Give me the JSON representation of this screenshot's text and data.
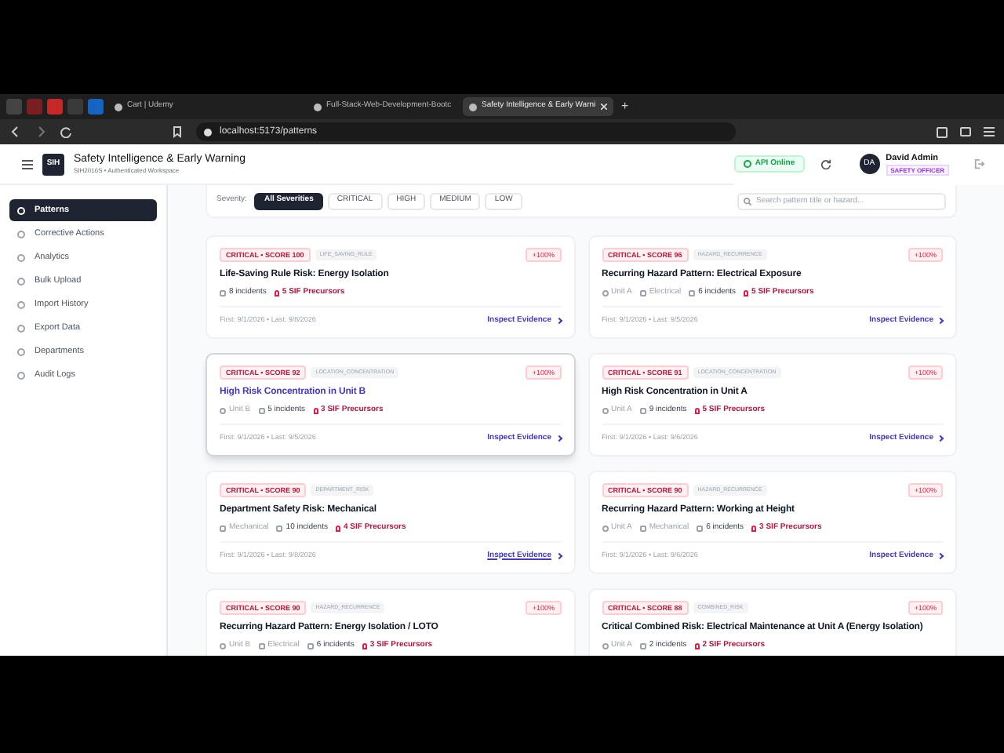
{
  "browser": {
    "tabs": [
      {
        "label": "Cart | Udemy",
        "selected": false
      },
      {
        "label": "Full-Stack-Web-Development-Bootc",
        "selected": false
      },
      {
        "label": "Safety Intelligence & Early Warni",
        "selected": true
      }
    ],
    "new_tab": "+",
    "url": "localhost:5173/patterns"
  },
  "header": {
    "logo": "SIH",
    "title": "Safety Intelligence & Early Warning",
    "subtitle": "SIH2016S • Authenticated Workspace",
    "api_status": "API Online",
    "user": {
      "initials": "DA",
      "name": "David Admin",
      "role": "SAFETY OFFICER"
    }
  },
  "sidebar": {
    "items": [
      {
        "label": "Patterns",
        "selected": true
      },
      {
        "label": "Corrective Actions",
        "selected": false
      },
      {
        "label": "Analytics",
        "selected": false
      },
      {
        "label": "Bulk Upload",
        "selected": false
      },
      {
        "label": "Import History",
        "selected": false
      },
      {
        "label": "Export Data",
        "selected": false
      },
      {
        "label": "Departments",
        "selected": false
      },
      {
        "label": "Audit Logs",
        "selected": false
      }
    ]
  },
  "filters": {
    "label": "Severity:",
    "options": [
      {
        "label": "All Severities",
        "selected": true
      },
      {
        "label": "CRITICAL",
        "selected": false
      },
      {
        "label": "HIGH",
        "selected": false
      },
      {
        "label": "MEDIUM",
        "selected": false
      },
      {
        "label": "LOW",
        "selected": false
      }
    ],
    "search_placeholder": "Search pattern title or hazard..."
  },
  "cards": [
    {
      "severity": "CRITICAL • SCORE 100",
      "category": "LIFE_SAVING_RULE",
      "change": "+100%",
      "title": "Life-Saving Rule Risk: Energy Isolation",
      "hovered": false,
      "meta": [
        {
          "kind": "incidents",
          "text": "8 incidents"
        }
      ],
      "sif": "5 SIF Precursors",
      "dates": "First: 9/1/2026 • Last: 9/8/2026",
      "link": "Inspect Evidence",
      "link_hovered": false
    },
    {
      "severity": "CRITICAL • SCORE 96",
      "category": "HAZARD_RECURRENCE",
      "change": "+100%",
      "title": "Recurring Hazard Pattern: Electrical Exposure",
      "hovered": false,
      "meta": [
        {
          "kind": "location",
          "text": "Unit A"
        },
        {
          "kind": "department",
          "text": "Electrical"
        },
        {
          "kind": "incidents",
          "text": "6 incidents"
        }
      ],
      "sif": "5 SIF Precursors",
      "dates": "First: 9/1/2026 • Last: 9/5/2026",
      "link": "Inspect Evidence",
      "link_hovered": false
    },
    {
      "severity": "CRITICAL • SCORE 92",
      "category": "LOCATION_CONCENTRATION",
      "change": "+100%",
      "title": "High Risk Concentration in Unit B",
      "hovered": true,
      "meta": [
        {
          "kind": "location",
          "text": "Unit B"
        },
        {
          "kind": "incidents",
          "text": "5 incidents"
        }
      ],
      "sif": "3 SIF Precursors",
      "dates": "First: 9/1/2026 • Last: 9/5/2026",
      "link": "Inspect Evidence",
      "link_hovered": false
    },
    {
      "severity": "CRITICAL • SCORE 91",
      "category": "LOCATION_CONCENTRATION",
      "change": "+100%",
      "title": "High Risk Concentration in Unit A",
      "hovered": false,
      "meta": [
        {
          "kind": "location",
          "text": "Unit A"
        },
        {
          "kind": "incidents",
          "text": "9 incidents"
        }
      ],
      "sif": "5 SIF Precursors",
      "dates": "First: 9/1/2026 • Last: 9/6/2026",
      "link": "Inspect Evidence",
      "link_hovered": false
    },
    {
      "severity": "CRITICAL • SCORE 90",
      "category": "DEPARTMENT_RISK",
      "title": "Department Safety Risk: Mechanical",
      "hovered": false,
      "meta": [
        {
          "kind": "department",
          "text": "Mechanical"
        },
        {
          "kind": "incidents",
          "text": "10 incidents"
        }
      ],
      "sif": "4 SIF Precursors",
      "dates": "First: 9/1/2026 • Last: 9/8/2026",
      "link": "Inspect Evidence",
      "link_hovered": true
    },
    {
      "severity": "CRITICAL • SCORE 90",
      "category": "HAZARD_RECURRENCE",
      "change": "+100%",
      "title": "Recurring Hazard Pattern: Working at Height",
      "hovered": false,
      "meta": [
        {
          "kind": "location",
          "text": "Unit A"
        },
        {
          "kind": "department",
          "text": "Mechanical"
        },
        {
          "kind": "incidents",
          "text": "6 incidents"
        }
      ],
      "sif": "3 SIF Precursors",
      "dates": "First: 9/1/2026 • Last: 9/6/2026",
      "link": "Inspect Evidence",
      "link_hovered": false
    },
    {
      "severity": "CRITICAL • SCORE 90",
      "category": "HAZARD_RECURRENCE",
      "change": "+100%",
      "title": "Recurring Hazard Pattern: Energy Isolation / LOTO",
      "hovered": false,
      "meta": [
        {
          "kind": "location",
          "text": "Unit B"
        },
        {
          "kind": "department",
          "text": "Electrical"
        },
        {
          "kind": "incidents",
          "text": "6 incidents"
        }
      ],
      "sif": "3 SIF Precursors"
    },
    {
      "severity": "CRITICAL • SCORE 88",
      "category": "COMBINED_RISK",
      "change": "+100%",
      "title": "Critical Combined Risk: Electrical Maintenance at Unit A (Energy Isolation)",
      "hovered": false,
      "meta": [
        {
          "kind": "location",
          "text": "Unit A"
        },
        {
          "kind": "incidents",
          "text": "2 incidents"
        }
      ],
      "sif": "2 SIF Precursors"
    }
  ]
}
